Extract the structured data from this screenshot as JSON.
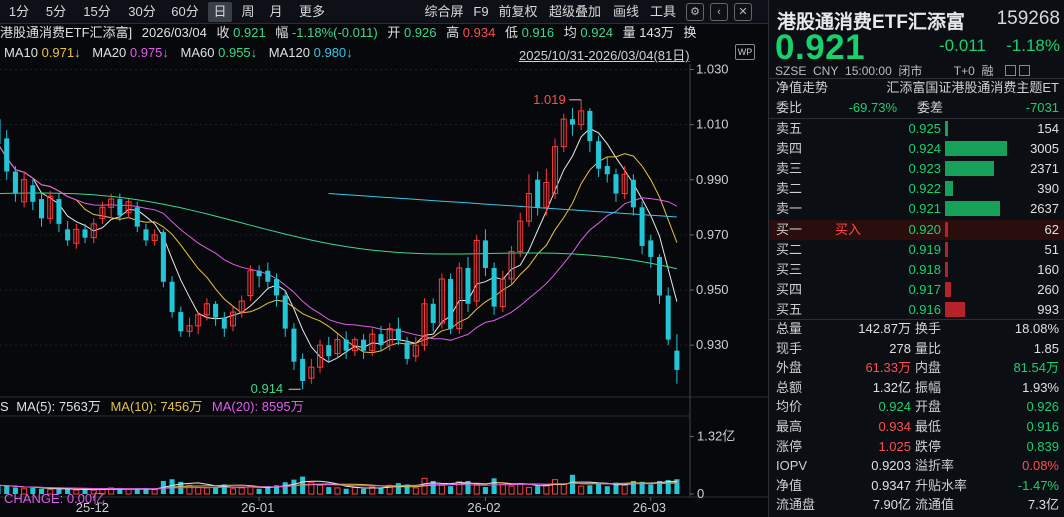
{
  "toolbar": {
    "periods": [
      "1分",
      "5分",
      "15分",
      "30分",
      "60分",
      "日",
      "周",
      "月",
      "更多"
    ],
    "selected": "日",
    "right_items": [
      "综合屏",
      "F9",
      "前复权",
      "超级叠加",
      "画线",
      "工具"
    ],
    "icons": [
      "gear-icon",
      "chevron-left-icon",
      "close-icon"
    ]
  },
  "info": {
    "name": "港股通消费ETF汇添富]",
    "date": "2026/03/04",
    "close_label": "收",
    "close": "0.921",
    "amp_label": "幅",
    "amp": "-1.18%(-0.011)",
    "open_label": "开",
    "open": "0.926",
    "high_label": "高",
    "high": "0.934",
    "low_label": "低",
    "low": "0.916",
    "avg_label": "均",
    "avg": "0.924",
    "vol_label": "量",
    "vol": "143万",
    "turn_label": "换"
  },
  "ma": {
    "ma10_label": "MA10",
    "ma10": "0.971↓",
    "ma20_label": "MA20",
    "ma20": "0.975↓",
    "ma60_label": "MA60",
    "ma60": "0.955↓",
    "ma120_label": "MA120",
    "ma120": "0.980↓"
  },
  "range_text": "2025/10/31-2026/03/04(81日)",
  "chip_text": "WP",
  "price_axis": [
    "1.030",
    "1.010",
    "0.990",
    "0.970",
    "0.950",
    "0.930"
  ],
  "annotations": {
    "high": "1.019",
    "low": "0.914"
  },
  "vol_ma": {
    "ma5_label": "MA(5):",
    "ma5": "7563万",
    "ma10_label": "MA(10):",
    "ma10": "7456万",
    "ma20_label": "MA(20):",
    "ma20": "8595万",
    "prefix": "S"
  },
  "vol_axis": [
    "1.32亿",
    "0"
  ],
  "change_text": "CHANGE: 0.00亿",
  "date_axis": [
    "25-12",
    "26-01",
    "26-02",
    "26-03"
  ],
  "chart_data": {
    "type": "candlestick",
    "ylim": [
      0.913,
      1.032
    ],
    "high_point": 1.019,
    "low_point": 0.914,
    "candles": [
      [
        1.012,
        1.003,
        1.015,
        1.0
      ],
      [
        1.005,
        0.993,
        1.008,
        0.99
      ],
      [
        0.993,
        0.985,
        0.995,
        0.982
      ],
      [
        0.982,
        0.99,
        0.993,
        0.98
      ],
      [
        0.988,
        0.982,
        0.99,
        0.979
      ],
      [
        0.983,
        0.976,
        0.985,
        0.973
      ],
      [
        0.976,
        0.984,
        0.986,
        0.974
      ],
      [
        0.983,
        0.974,
        0.985,
        0.971
      ],
      [
        0.972,
        0.968,
        0.975,
        0.966
      ],
      [
        0.967,
        0.972,
        0.974,
        0.965
      ],
      [
        0.972,
        0.969,
        0.974,
        0.967
      ],
      [
        0.969,
        0.974,
        0.976,
        0.967
      ],
      [
        0.976,
        0.98,
        0.982,
        0.974
      ],
      [
        0.98,
        0.983,
        0.985,
        0.976
      ],
      [
        0.983,
        0.977,
        0.985,
        0.975
      ],
      [
        0.978,
        0.982,
        0.983,
        0.976
      ],
      [
        0.98,
        0.973,
        0.982,
        0.971
      ],
      [
        0.972,
        0.968,
        0.974,
        0.966
      ],
      [
        0.968,
        0.97,
        0.972,
        0.966
      ],
      [
        0.971,
        0.953,
        0.972,
        0.951
      ],
      [
        0.953,
        0.942,
        0.955,
        0.94
      ],
      [
        0.942,
        0.935,
        0.944,
        0.933
      ],
      [
        0.935,
        0.937,
        0.94,
        0.933
      ],
      [
        0.937,
        0.941,
        0.942,
        0.934
      ],
      [
        0.941,
        0.945,
        0.947,
        0.939
      ],
      [
        0.945,
        0.94,
        0.946,
        0.937
      ],
      [
        0.94,
        0.936,
        0.942,
        0.933
      ],
      [
        0.937,
        0.942,
        0.944,
        0.935
      ],
      [
        0.942,
        0.946,
        0.948,
        0.94
      ],
      [
        0.948,
        0.957,
        0.959,
        0.946
      ],
      [
        0.957,
        0.955,
        0.959,
        0.951
      ],
      [
        0.957,
        0.953,
        0.96,
        0.95
      ],
      [
        0.954,
        0.948,
        0.956,
        0.944
      ],
      [
        0.948,
        0.936,
        0.95,
        0.933
      ],
      [
        0.936,
        0.924,
        0.938,
        0.921
      ],
      [
        0.925,
        0.917,
        0.927,
        0.914
      ],
      [
        0.918,
        0.922,
        0.925,
        0.916
      ],
      [
        0.922,
        0.93,
        0.932,
        0.92
      ],
      [
        0.93,
        0.926,
        0.933,
        0.924
      ],
      [
        0.927,
        0.932,
        0.934,
        0.925
      ],
      [
        0.932,
        0.928,
        0.935,
        0.925
      ],
      [
        0.928,
        0.932,
        0.933,
        0.926
      ],
      [
        0.932,
        0.928,
        0.934,
        0.925
      ],
      [
        0.928,
        0.934,
        0.936,
        0.926
      ],
      [
        0.934,
        0.93,
        0.937,
        0.928
      ],
      [
        0.93,
        0.936,
        0.938,
        0.928
      ],
      [
        0.936,
        0.932,
        0.94,
        0.93
      ],
      [
        0.931,
        0.925,
        0.933,
        0.923
      ],
      [
        0.926,
        0.93,
        0.933,
        0.924
      ],
      [
        0.93,
        0.945,
        0.947,
        0.928
      ],
      [
        0.945,
        0.938,
        0.947,
        0.935
      ],
      [
        0.938,
        0.954,
        0.956,
        0.936
      ],
      [
        0.954,
        0.936,
        0.956,
        0.934
      ],
      [
        0.936,
        0.958,
        0.96,
        0.934
      ],
      [
        0.958,
        0.945,
        0.962,
        0.942
      ],
      [
        0.946,
        0.968,
        0.97,
        0.944
      ],
      [
        0.968,
        0.958,
        0.972,
        0.955
      ],
      [
        0.958,
        0.944,
        0.96,
        0.941
      ],
      [
        0.944,
        0.954,
        0.957,
        0.942
      ],
      [
        0.954,
        0.964,
        0.966,
        0.952
      ],
      [
        0.964,
        0.975,
        0.978,
        0.962
      ],
      [
        0.975,
        0.985,
        0.992,
        0.973
      ],
      [
        0.99,
        0.98,
        0.993,
        0.977
      ],
      [
        0.98,
        0.989,
        0.994,
        0.977
      ],
      [
        0.985,
        1.002,
        1.005,
        0.983
      ],
      [
        1.002,
        1.012,
        1.014,
        1.0
      ],
      [
        1.012,
        1.01,
        1.016,
        1.006
      ],
      [
        1.01,
        1.015,
        1.019,
        1.008
      ],
      [
        1.015,
        1.004,
        1.016,
        1.0
      ],
      [
        1.004,
        0.994,
        1.006,
        0.991
      ],
      [
        0.995,
        0.992,
        0.998,
        0.989
      ],
      [
        0.992,
        0.985,
        0.994,
        0.982
      ],
      [
        0.985,
        0.992,
        0.995,
        0.983
      ],
      [
        0.99,
        0.98,
        0.992,
        0.977
      ],
      [
        0.98,
        0.966,
        0.982,
        0.963
      ],
      [
        0.968,
        0.962,
        0.97,
        0.958
      ],
      [
        0.962,
        0.948,
        0.963,
        0.945
      ],
      [
        0.948,
        0.932,
        0.951,
        0.93
      ],
      [
        0.928,
        0.921,
        0.934,
        0.916
      ]
    ],
    "volumes": [
      0.2,
      0.18,
      0.15,
      0.12,
      0.14,
      0.12,
      0.1,
      0.11,
      0.12,
      0.09,
      0.1,
      0.09,
      0.12,
      0.14,
      0.1,
      0.12,
      0.11,
      0.13,
      0.1,
      0.3,
      0.34,
      0.28,
      0.2,
      0.15,
      0.14,
      0.16,
      0.22,
      0.12,
      0.14,
      0.17,
      0.12,
      0.18,
      0.2,
      0.27,
      0.33,
      0.4,
      0.26,
      0.2,
      0.16,
      0.14,
      0.12,
      0.15,
      0.12,
      0.16,
      0.15,
      0.2,
      0.25,
      0.22,
      0.14,
      0.36,
      0.3,
      0.2,
      0.18,
      0.28,
      0.3,
      0.22,
      0.16,
      0.36,
      0.22,
      0.18,
      0.24,
      0.15,
      0.18,
      0.2,
      0.33,
      0.22,
      0.44,
      0.18,
      0.2,
      0.24,
      0.18,
      0.26,
      0.2,
      0.3,
      0.28,
      0.22,
      0.3,
      0.32,
      0.34
    ],
    "vol_ylim": [
      0,
      1.7
    ],
    "series": [
      {
        "name": "MA5",
        "color": "#e8e8e8"
      },
      {
        "name": "MA10",
        "color": "#e8c341"
      },
      {
        "name": "MA20",
        "color": "#e05ee8"
      },
      {
        "name": "MA60",
        "color": "#3bd98a"
      },
      {
        "name": "MA120",
        "color": "#38c6e6"
      }
    ],
    "colors": {
      "up": "#ff3b3b",
      "down": "#22c6d6"
    }
  },
  "quote": {
    "name": "港股通消费ETF汇添富",
    "code": "159268",
    "price": "0.921",
    "change": "-0.011",
    "pct": "-1.18%",
    "sub_exchange": "SZSE",
    "sub_currency": "CNY",
    "sub_time": "15:00:00",
    "sub_status": "闭市",
    "sub_t0": "T+0",
    "sub_extra": "融",
    "trend_label": "净值走势",
    "trend_value": "汇添富国证港股通消费主题ET",
    "wb_label": "委比",
    "wb_value": "-69.73%",
    "wc_label": "委差",
    "wc_value": "-7031"
  },
  "asks": [
    {
      "label": "卖五",
      "price": "0.925",
      "vol": "154",
      "ratio": 0.05
    },
    {
      "label": "卖四",
      "price": "0.924",
      "vol": "3005",
      "ratio": 1.0
    },
    {
      "label": "卖三",
      "price": "0.923",
      "vol": "2371",
      "ratio": 0.79
    },
    {
      "label": "卖二",
      "price": "0.922",
      "vol": "390",
      "ratio": 0.13
    },
    {
      "label": "卖一",
      "price": "0.921",
      "vol": "2637",
      "ratio": 0.88
    }
  ],
  "bids": [
    {
      "label": "买一",
      "price": "0.920",
      "vol": "62",
      "ratio": 0.02,
      "tag": "买入"
    },
    {
      "label": "买二",
      "price": "0.919",
      "vol": "51",
      "ratio": 0.02
    },
    {
      "label": "买三",
      "price": "0.918",
      "vol": "160",
      "ratio": 0.05
    },
    {
      "label": "买四",
      "price": "0.917",
      "vol": "260",
      "ratio": 0.09
    },
    {
      "label": "买五",
      "price": "0.916",
      "vol": "993",
      "ratio": 0.33
    }
  ],
  "stats": [
    {
      "l1": "总量",
      "v1": "142.87万",
      "c1": "white",
      "l2": "换手",
      "v2": "18.08%",
      "c2": "white"
    },
    {
      "l1": "现手",
      "v1": "278",
      "c1": "white",
      "l2": "量比",
      "v2": "1.85",
      "c2": "white"
    },
    {
      "l1": "外盘",
      "v1": "61.33万",
      "c1": "red",
      "l2": "内盘",
      "v2": "81.54万",
      "c2": "green"
    },
    {
      "l1": "总额",
      "v1": "1.32亿",
      "c1": "white",
      "l2": "振幅",
      "v2": "1.93%",
      "c2": "white"
    },
    {
      "l1": "均价",
      "v1": "0.924",
      "c1": "green",
      "l2": "开盘",
      "v2": "0.926",
      "c2": "green"
    },
    {
      "l1": "最高",
      "v1": "0.934",
      "c1": "red",
      "l2": "最低",
      "v2": "0.916",
      "c2": "green"
    },
    {
      "l1": "涨停",
      "v1": "1.025",
      "c1": "red",
      "l2": "跌停",
      "v2": "0.839",
      "c2": "green"
    },
    {
      "l1": "IOPV",
      "v1": "0.9203",
      "c1": "white",
      "l2": "溢折率",
      "v2": "0.08%",
      "c2": "red"
    },
    {
      "l1": "净值",
      "v1": "0.9347",
      "c1": "white",
      "l2": "升贴水率",
      "v2": "-1.47%",
      "c2": "green"
    },
    {
      "l1": "流通盘",
      "v1": "7.90亿",
      "c1": "white",
      "l2": "流通值",
      "v2": "7.3亿",
      "c2": "white"
    }
  ]
}
